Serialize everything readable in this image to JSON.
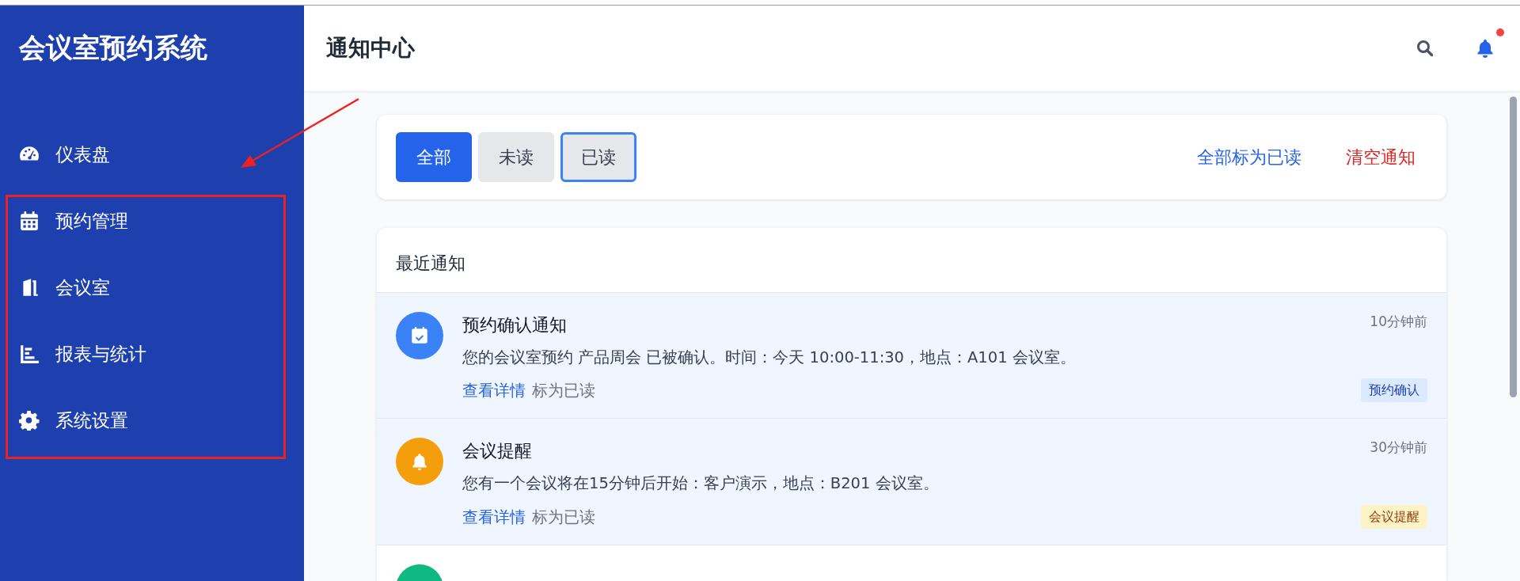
{
  "sidebar": {
    "title": "会议室预约系统",
    "items": [
      {
        "label": "仪表盘",
        "kind": "gauge",
        "selected": false
      },
      {
        "label": "预约管理",
        "kind": "calendar",
        "selected": false
      },
      {
        "label": "会议室",
        "kind": "door",
        "selected": false
      },
      {
        "label": "报表与统计",
        "kind": "chart",
        "selected": false
      },
      {
        "label": "系统设置",
        "kind": "gear",
        "selected": false
      }
    ]
  },
  "header": {
    "title": "通知中心",
    "has_unread_dot": true
  },
  "filters": {
    "tabs": [
      {
        "label": "全部",
        "selected": true
      },
      {
        "label": "未读",
        "selected": false
      },
      {
        "label": "已读",
        "selected": false,
        "focused": true
      }
    ],
    "actions": [
      {
        "label": "全部标为已读",
        "kind": "primary"
      },
      {
        "label": "清空通知",
        "kind": "danger"
      }
    ]
  },
  "notifications": {
    "title": "最近通知",
    "items": [
      {
        "kind": "booking",
        "color": "#3b82f6",
        "unread": true,
        "title": "预约确认通知",
        "time": "10分钟前",
        "text": "您的会议室预约 产品周会 已被确认。时间：今天 10:00-11:30，地点：A101 会议室。",
        "links": [
          "查看详情",
          "标为已读"
        ],
        "tag": "预约确认"
      },
      {
        "kind": "reminder",
        "color": "#f59e0b",
        "unread": true,
        "title": "会议提醒",
        "time": "30分钟前",
        "text": "您有一个会议将在15分钟后开始：客户演示，地点：B201 会议室。",
        "links": [
          "查看详情",
          "标为已读"
        ],
        "tag": "会议提醒"
      },
      {
        "kind": "other",
        "color": "#10b981",
        "unread": false
      }
    ]
  },
  "annotations": {
    "arrow": true,
    "highlight_box": true
  }
}
